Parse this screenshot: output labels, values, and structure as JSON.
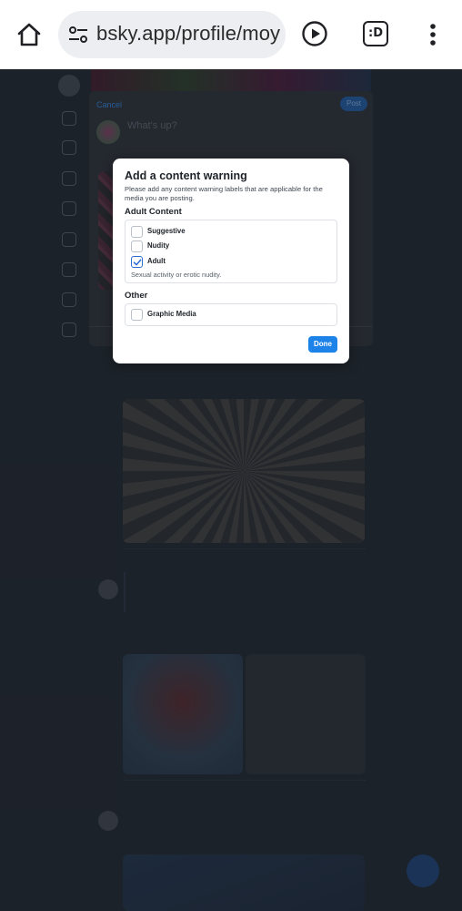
{
  "browser": {
    "url": "bsky.app/profile/moy",
    "extension_label": ":D"
  },
  "compose": {
    "cancel_label": "Cancel",
    "post_label": "Post",
    "placeholder": "What's up?"
  },
  "modal": {
    "title": "Add a content warning",
    "description": "Please add any content warning labels that are applicable for the media you are posting.",
    "adult_section_label": "Adult Content",
    "adult_options": [
      {
        "label": "Suggestive",
        "checked": false
      },
      {
        "label": "Nudity",
        "checked": false
      },
      {
        "label": "Adult",
        "checked": true
      }
    ],
    "adult_hint": "Sexual activity or erotic nudity.",
    "other_section_label": "Other",
    "other_options": [
      {
        "label": "Graphic Media",
        "checked": false
      }
    ],
    "done_label": "Done"
  },
  "colors": {
    "accent": "#1d83e8",
    "backdrop": "#222831"
  }
}
